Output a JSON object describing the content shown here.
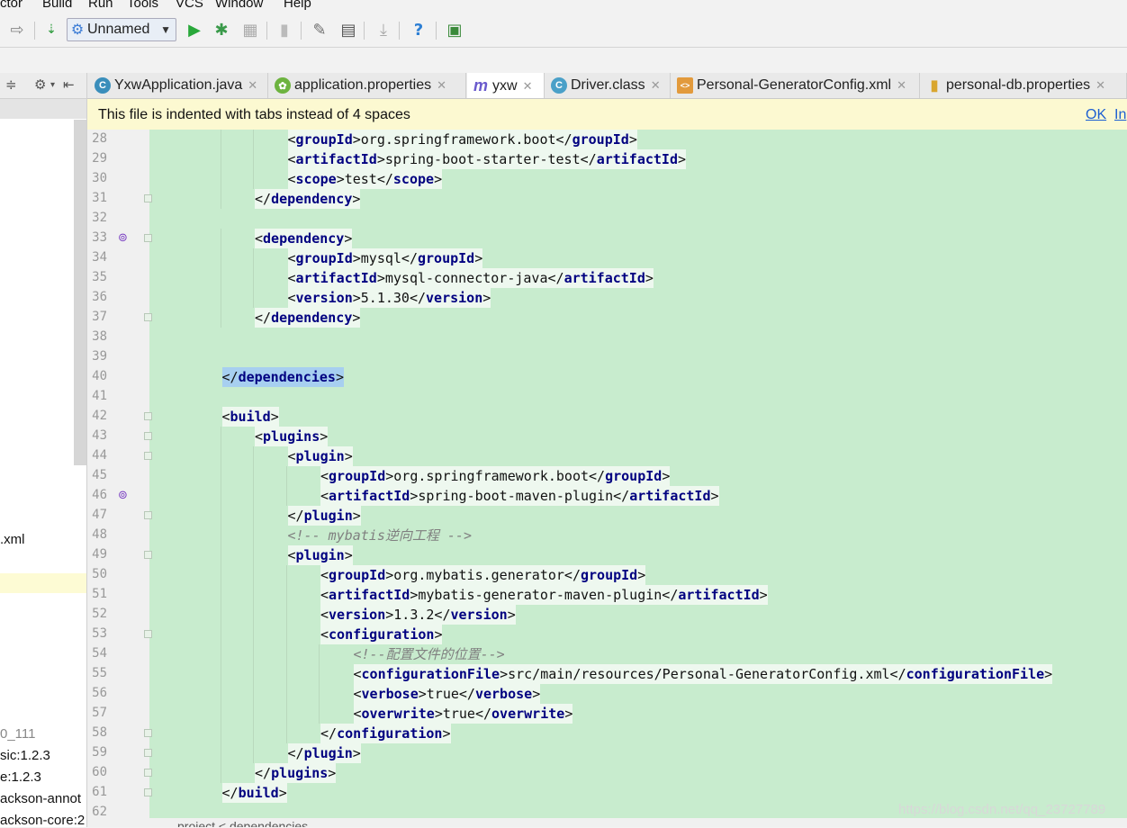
{
  "menu": [
    "ctor",
    "Build",
    "Run",
    "Tools",
    "VCS",
    "Window",
    "Help"
  ],
  "toolbar": {
    "run_config": "Unnamed",
    "icons": [
      "forward-arrow-icon",
      "sort-icon",
      "run-icon",
      "debug-icon",
      "coverage-icon",
      "stop-icon",
      "settings-icon",
      "structure-icon",
      "download-icon",
      "help-icon",
      "plugin-icon"
    ]
  },
  "left_panel": {
    "items": [
      ".xml",
      "0_111",
      "sic:1.2.3",
      "e:1.2.3",
      "ackson-annot",
      "ackson-core:2"
    ]
  },
  "tabs": [
    {
      "label": "YxwApplication.java",
      "icon": "C",
      "icon_color": "#3a8ebb"
    },
    {
      "label": "application.properties",
      "icon": "✿",
      "icon_color": "#6db33f"
    },
    {
      "label": "yxw",
      "icon": "m",
      "icon_color": "#6a5acd"
    },
    {
      "label": "Driver.class",
      "icon": "C",
      "icon_color": "#4aa0c8"
    },
    {
      "label": "Personal-GeneratorConfig.xml",
      "icon": "<>",
      "icon_color": "#e29a3c"
    },
    {
      "label": "personal-db.properties",
      "icon": "▮",
      "icon_color": "#d9a62e"
    }
  ],
  "banner": {
    "message": "This file is indented with tabs instead of 4 spaces",
    "ok": "OK",
    "ignore": "In"
  },
  "code_lines": [
    {
      "n": "28",
      "indent": 3,
      "parts": [
        [
          "<",
          ""
        ],
        [
          "groupId",
          "t"
        ],
        [
          ">org.springframework.boot</",
          ""
        ],
        [
          "groupId",
          "t"
        ],
        [
          ">",
          ""
        ]
      ]
    },
    {
      "n": "29",
      "indent": 3,
      "parts": [
        [
          "<",
          ""
        ],
        [
          "artifactId",
          "t"
        ],
        [
          ">spring-boot-starter-test</",
          ""
        ],
        [
          "artifactId",
          "t"
        ],
        [
          ">",
          ""
        ]
      ]
    },
    {
      "n": "30",
      "indent": 3,
      "parts": [
        [
          "<",
          ""
        ],
        [
          "scope",
          "t"
        ],
        [
          ">test</",
          ""
        ],
        [
          "scope",
          "t"
        ],
        [
          ">",
          ""
        ]
      ]
    },
    {
      "n": "31",
      "indent": 2,
      "fold": true,
      "parts": [
        [
          "</",
          ""
        ],
        [
          "dependency",
          "t"
        ],
        [
          ">",
          ""
        ]
      ]
    },
    {
      "n": "32",
      "indent": 0,
      "parts": []
    },
    {
      "n": "33",
      "indent": 2,
      "fold": true,
      "mark": true,
      "parts": [
        [
          "<",
          ""
        ],
        [
          "dependency",
          "t"
        ],
        [
          ">",
          ""
        ]
      ]
    },
    {
      "n": "34",
      "indent": 3,
      "parts": [
        [
          "<",
          ""
        ],
        [
          "groupId",
          "t"
        ],
        [
          ">mysql</",
          ""
        ],
        [
          "groupId",
          "t"
        ],
        [
          ">",
          ""
        ]
      ]
    },
    {
      "n": "35",
      "indent": 3,
      "parts": [
        [
          "<",
          ""
        ],
        [
          "artifactId",
          "t"
        ],
        [
          ">mysql-connector-java</",
          ""
        ],
        [
          "artifactId",
          "t"
        ],
        [
          ">",
          ""
        ]
      ]
    },
    {
      "n": "36",
      "indent": 3,
      "parts": [
        [
          "<",
          ""
        ],
        [
          "version",
          "t"
        ],
        [
          ">5.1.30</",
          ""
        ],
        [
          "version",
          "t"
        ],
        [
          ">",
          ""
        ]
      ]
    },
    {
      "n": "37",
      "indent": 2,
      "fold": true,
      "parts": [
        [
          "</",
          ""
        ],
        [
          "dependency",
          "t"
        ],
        [
          ">",
          ""
        ]
      ]
    },
    {
      "n": "38",
      "indent": 0,
      "parts": []
    },
    {
      "n": "39",
      "indent": 0,
      "parts": []
    },
    {
      "n": "40",
      "indent": 1,
      "sel": true,
      "parts": [
        [
          "</",
          ""
        ],
        [
          "dependencies",
          "t"
        ],
        [
          ">",
          ""
        ]
      ]
    },
    {
      "n": "41",
      "indent": 0,
      "parts": []
    },
    {
      "n": "42",
      "indent": 1,
      "fold": true,
      "parts": [
        [
          "<",
          ""
        ],
        [
          "build",
          "t"
        ],
        [
          ">",
          ""
        ]
      ]
    },
    {
      "n": "43",
      "indent": 2,
      "fold": true,
      "parts": [
        [
          "<",
          ""
        ],
        [
          "plugins",
          "t"
        ],
        [
          ">",
          ""
        ]
      ]
    },
    {
      "n": "44",
      "indent": 3,
      "fold": true,
      "parts": [
        [
          "<",
          ""
        ],
        [
          "plugin",
          "t"
        ],
        [
          ">",
          ""
        ]
      ]
    },
    {
      "n": "45",
      "indent": 4,
      "parts": [
        [
          "<",
          ""
        ],
        [
          "groupId",
          "t"
        ],
        [
          ">org.springframework.boot</",
          ""
        ],
        [
          "groupId",
          "t"
        ],
        [
          ">",
          ""
        ]
      ]
    },
    {
      "n": "46",
      "indent": 4,
      "mark": true,
      "parts": [
        [
          "<",
          ""
        ],
        [
          "artifactId",
          "t"
        ],
        [
          ">spring-boot-maven-plugin</",
          ""
        ],
        [
          "artifactId",
          "t"
        ],
        [
          ">",
          ""
        ]
      ]
    },
    {
      "n": "47",
      "indent": 3,
      "fold": true,
      "parts": [
        [
          "</",
          ""
        ],
        [
          "plugin",
          "t"
        ],
        [
          ">",
          ""
        ]
      ]
    },
    {
      "n": "48",
      "indent": 3,
      "comment": true,
      "parts": [
        [
          "<!-- mybatis逆向工程 -->",
          ""
        ]
      ]
    },
    {
      "n": "49",
      "indent": 3,
      "fold": true,
      "parts": [
        [
          "<",
          ""
        ],
        [
          "plugin",
          "t"
        ],
        [
          ">",
          ""
        ]
      ]
    },
    {
      "n": "50",
      "indent": 4,
      "parts": [
        [
          "<",
          ""
        ],
        [
          "groupId",
          "t"
        ],
        [
          ">org.mybatis.generator</",
          ""
        ],
        [
          "groupId",
          "t"
        ],
        [
          ">",
          ""
        ]
      ]
    },
    {
      "n": "51",
      "indent": 4,
      "parts": [
        [
          "<",
          ""
        ],
        [
          "artifactId",
          "t"
        ],
        [
          ">mybatis-generator-maven-plugin</",
          ""
        ],
        [
          "artifactId",
          "t"
        ],
        [
          ">",
          ""
        ]
      ]
    },
    {
      "n": "52",
      "indent": 4,
      "parts": [
        [
          "<",
          ""
        ],
        [
          "version",
          "t"
        ],
        [
          ">1.3.2</",
          ""
        ],
        [
          "version",
          "t"
        ],
        [
          ">",
          ""
        ]
      ]
    },
    {
      "n": "53",
      "indent": 4,
      "fold": true,
      "parts": [
        [
          "<",
          ""
        ],
        [
          "configuration",
          "t"
        ],
        [
          ">",
          ""
        ]
      ]
    },
    {
      "n": "54",
      "indent": 5,
      "comment": true,
      "parts": [
        [
          "<!--配置文件的位置-->",
          ""
        ]
      ]
    },
    {
      "n": "55",
      "indent": 5,
      "parts": [
        [
          "<",
          ""
        ],
        [
          "configurationFile",
          "t"
        ],
        [
          ">src/main/resources/Personal-GeneratorConfig.xml</",
          ""
        ],
        [
          "configurationFile",
          "t"
        ],
        [
          ">",
          ""
        ]
      ]
    },
    {
      "n": "56",
      "indent": 5,
      "parts": [
        [
          "<",
          ""
        ],
        [
          "verbose",
          "t"
        ],
        [
          ">true</",
          ""
        ],
        [
          "verbose",
          "t"
        ],
        [
          ">",
          ""
        ]
      ]
    },
    {
      "n": "57",
      "indent": 5,
      "parts": [
        [
          "<",
          ""
        ],
        [
          "overwrite",
          "t"
        ],
        [
          ">true</",
          ""
        ],
        [
          "overwrite",
          "t"
        ],
        [
          ">",
          ""
        ]
      ]
    },
    {
      "n": "58",
      "indent": 4,
      "fold": true,
      "parts": [
        [
          "</",
          ""
        ],
        [
          "configuration",
          "t"
        ],
        [
          ">",
          ""
        ]
      ]
    },
    {
      "n": "59",
      "indent": 3,
      "fold": true,
      "parts": [
        [
          "</",
          ""
        ],
        [
          "plugin",
          "t"
        ],
        [
          ">",
          ""
        ]
      ]
    },
    {
      "n": "60",
      "indent": 2,
      "fold": true,
      "parts": [
        [
          "</",
          ""
        ],
        [
          "plugins",
          "t"
        ],
        [
          ">",
          ""
        ]
      ]
    },
    {
      "n": "61",
      "indent": 1,
      "fold": true,
      "parts": [
        [
          "</",
          ""
        ],
        [
          "build",
          "t"
        ],
        [
          ">",
          ""
        ]
      ]
    },
    {
      "n": "62",
      "indent": 0,
      "parts": []
    }
  ],
  "bottom_text": "project  <  dependencies",
  "watermark": "https://blog.csdn.net/qq_23727789"
}
